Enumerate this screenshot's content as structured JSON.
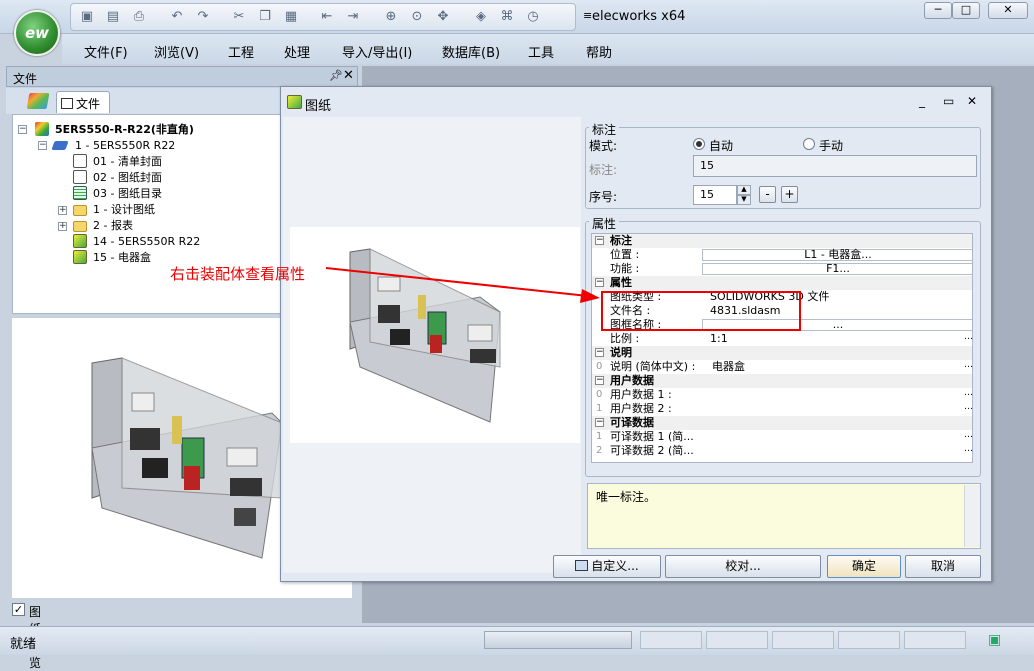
{
  "app": {
    "title": "elecworks x64",
    "logo": "ew"
  },
  "menu": [
    "文件(F)",
    "浏览(V)",
    "工程",
    "处理",
    "导入/导出(I)",
    "数据库(B)",
    "工具",
    "帮助"
  ],
  "left_panel": {
    "title": "文件",
    "tab_label": "文件",
    "tree": [
      {
        "label": "5ERS550-R-R22(非直角)",
        "bold": true
      },
      {
        "label": "1 - 5ERS550R R22"
      },
      {
        "label": "01 - 清单封面"
      },
      {
        "label": "02 - 图纸封面"
      },
      {
        "label": "03 - 图纸目录"
      },
      {
        "label": "1 - 设计图纸"
      },
      {
        "label": "2 - 报表"
      },
      {
        "label": "14 - 5ERS550R R22"
      },
      {
        "label": "15 - 电器盒"
      }
    ],
    "preview_checkbox": "图纸预览"
  },
  "dialog": {
    "title": "图纸",
    "annotation_group": "标注",
    "mode_label": "模式:",
    "mode_auto": "自动",
    "mode_manual": "手动",
    "mode_selected": "自动",
    "annotation_label": "标注:",
    "annotation_value": "15",
    "seq_label": "序号:",
    "seq_value": "15",
    "minus": "-",
    "plus": "+",
    "props_group": "属性",
    "props": {
      "sec_annotation": "标注",
      "position_key": "位置 :",
      "position_val": "L1 - 电器盒...",
      "function_key": "功能 :",
      "function_val": "F1...",
      "sec_properties": "属性",
      "type_key": "图纸类型 :",
      "type_val": "SOLIDWORKS 3D 文件",
      "file_key": "文件名 :",
      "file_val": "4831.sldasm",
      "template_key": "图框名称 :",
      "template_val": "...",
      "scale_key": "比例 :",
      "scale_val": "1:1",
      "sec_desc": "说明",
      "desc_key": "说明 (简体中文) :",
      "desc_val": "电器盒",
      "sec_user": "用户数据",
      "user1_key": "用户数据 1 :",
      "user2_key": "用户数据 2 :",
      "sec_trans": "可译数据",
      "trans1_key": "可译数据 1 (简...",
      "trans2_key": "可译数据 2 (简...",
      "idx0": "0",
      "idx1": "1",
      "idx2": "2"
    },
    "description_text": "唯一标注。",
    "buttons": {
      "custom": "自定义...",
      "check": "校对...",
      "ok": "确定",
      "cancel": "取消"
    }
  },
  "annotation_note": "右击装配体查看属性",
  "status": {
    "text": "就绪"
  },
  "colors": {
    "annotation": "#e00000",
    "highlight_box": "#e00000"
  }
}
